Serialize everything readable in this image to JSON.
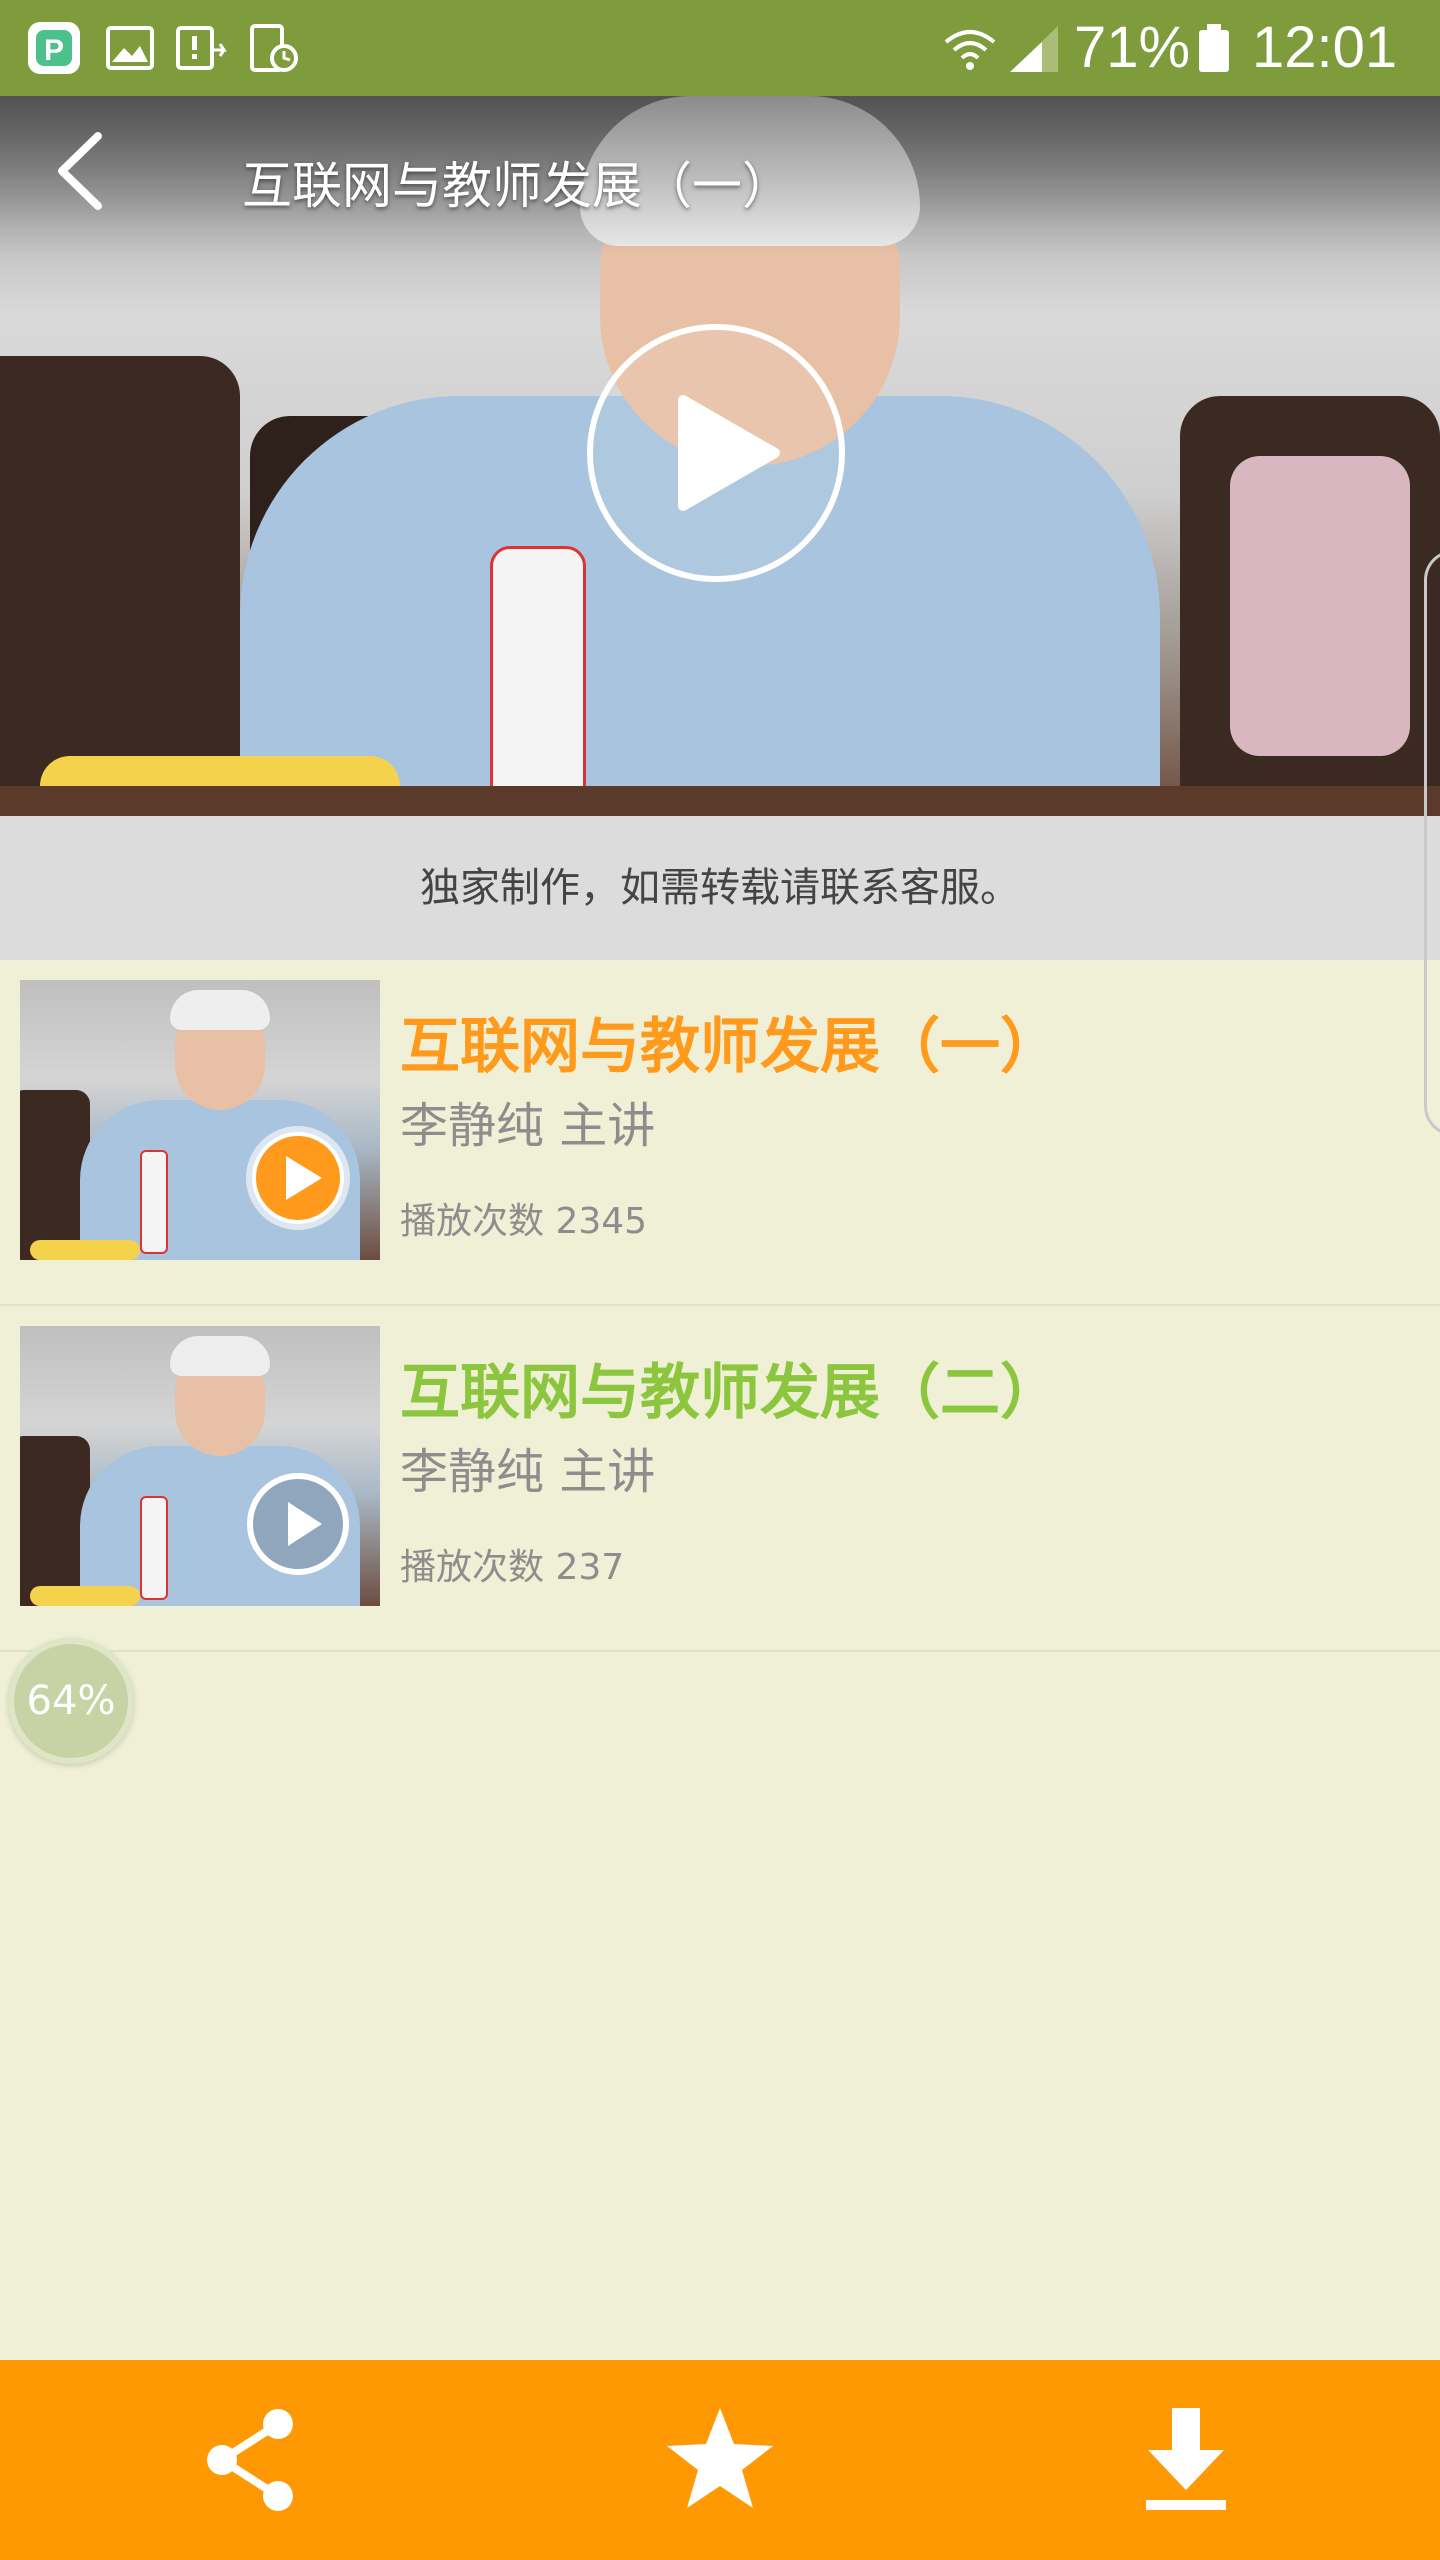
{
  "status_bar": {
    "battery": "71%",
    "time": "12:01"
  },
  "header": {
    "title": "互联网与教师发展（一）"
  },
  "notice": "独家制作，如需转载请联系客服。",
  "episodes": [
    {
      "title": "互联网与教师发展（一）",
      "presenter": "李静纯  主讲",
      "plays": "播放次数 2345",
      "title_color": "#ff9a1c",
      "active": true
    },
    {
      "title": "互联网与教师发展（二）",
      "presenter": "李静纯  主讲",
      "plays": "播放次数 237",
      "title_color": "#8cc63f",
      "active": false
    }
  ],
  "progress_badge": "64%",
  "bottom_bar": {
    "actions": [
      "share-icon",
      "star-icon",
      "download-icon"
    ]
  },
  "colors": {
    "status_bar": "#7f9c3c",
    "accent": "#fe9803",
    "background": "#f0f0d6"
  }
}
